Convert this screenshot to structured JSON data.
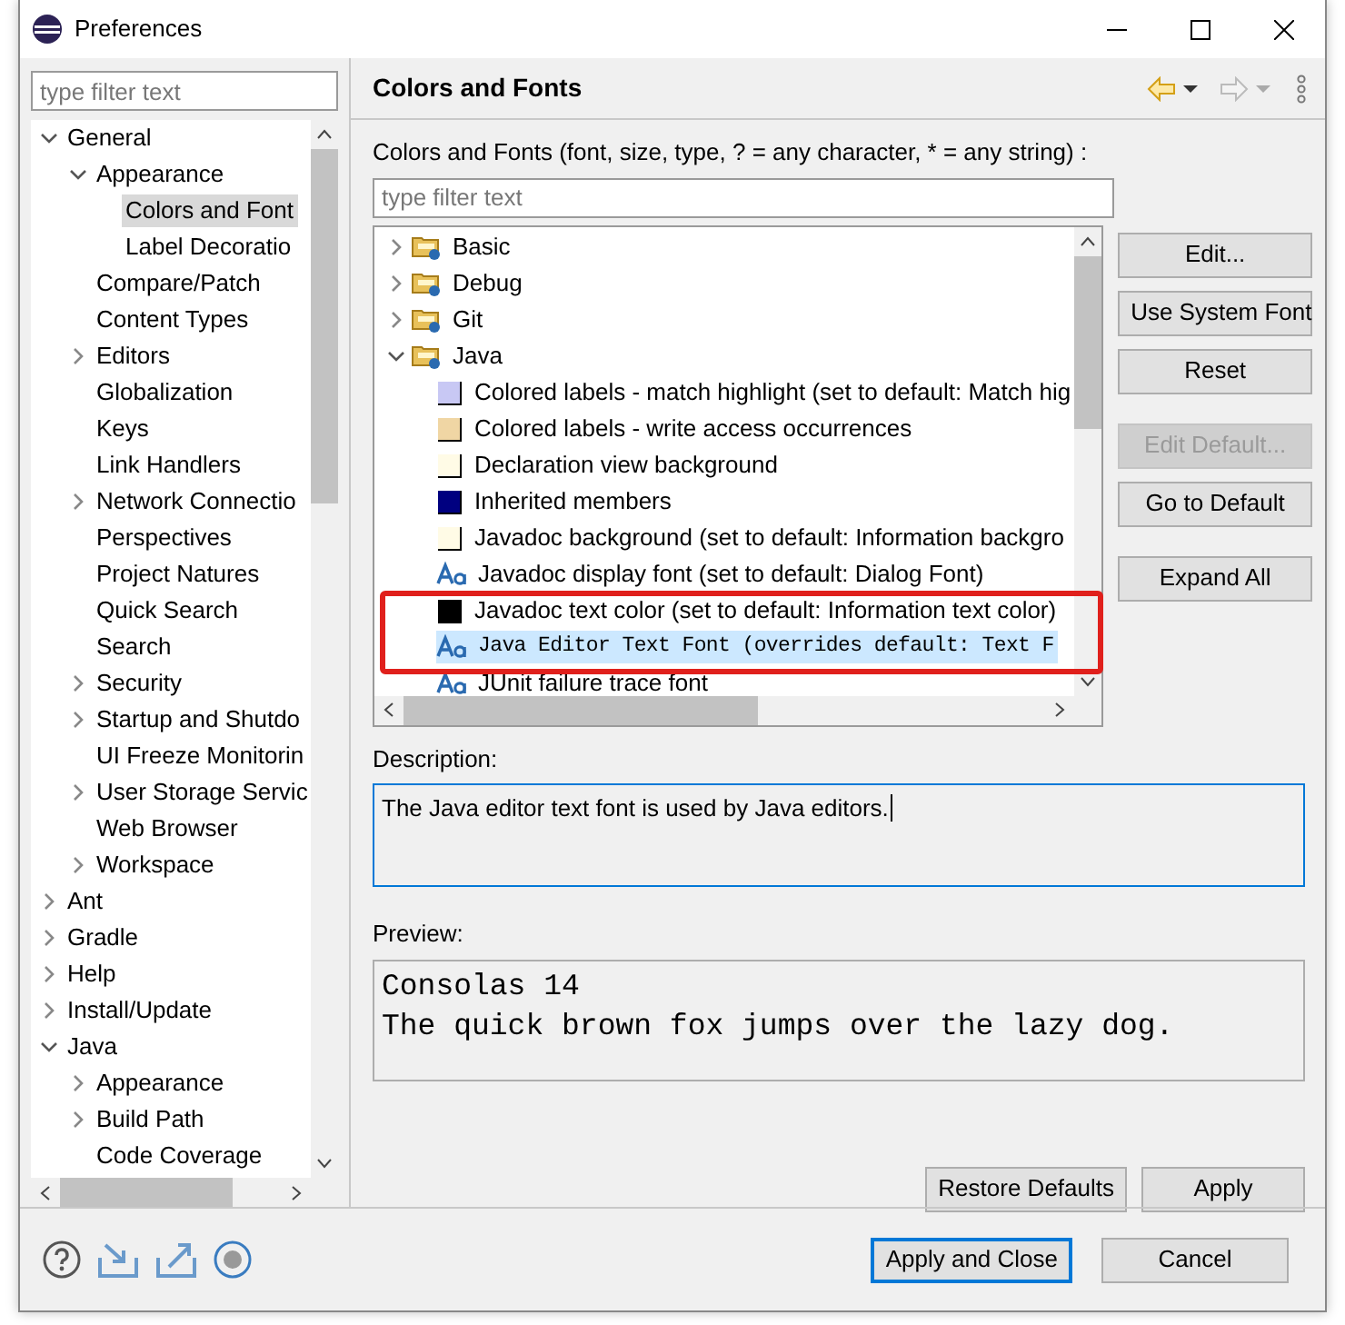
{
  "window": {
    "title": "Preferences"
  },
  "sidebar": {
    "filter": {
      "placeholder": "type filter text"
    },
    "items": [
      {
        "label": "General",
        "expanded": true,
        "selected": false,
        "children": [
          {
            "label": "Appearance",
            "expanded": true,
            "selected": false,
            "children": [
              {
                "label": "Colors and Font",
                "selected": true
              },
              {
                "label": "Label Decoratio",
                "selected": false
              }
            ]
          },
          {
            "label": "Compare/Patch",
            "selected": false
          },
          {
            "label": "Content Types",
            "selected": false
          },
          {
            "label": "Editors",
            "expanded": false,
            "selected": false
          },
          {
            "label": "Globalization",
            "selected": false
          },
          {
            "label": "Keys",
            "selected": false
          },
          {
            "label": "Link Handlers",
            "selected": false
          },
          {
            "label": "Network Connectio",
            "expanded": false,
            "selected": false
          },
          {
            "label": "Perspectives",
            "selected": false
          },
          {
            "label": "Project Natures",
            "selected": false
          },
          {
            "label": "Quick Search",
            "selected": false
          },
          {
            "label": "Search",
            "selected": false
          },
          {
            "label": "Security",
            "expanded": false,
            "selected": false
          },
          {
            "label": "Startup and Shutdo",
            "expanded": false,
            "selected": false
          },
          {
            "label": "UI Freeze Monitorin",
            "selected": false
          },
          {
            "label": "User Storage Servic",
            "expanded": false,
            "selected": false
          },
          {
            "label": "Web Browser",
            "selected": false
          },
          {
            "label": "Workspace",
            "expanded": false,
            "selected": false
          }
        ]
      },
      {
        "label": "Ant",
        "expanded": false,
        "selected": false
      },
      {
        "label": "Gradle",
        "expanded": false,
        "selected": false
      },
      {
        "label": "Help",
        "expanded": false,
        "selected": false
      },
      {
        "label": "Install/Update",
        "expanded": false,
        "selected": false
      },
      {
        "label": "Java",
        "expanded": true,
        "selected": false,
        "children": [
          {
            "label": "Appearance",
            "expanded": false,
            "selected": false
          },
          {
            "label": "Build Path",
            "expanded": false,
            "selected": false
          },
          {
            "label": "Code Coverage",
            "selected": false
          }
        ]
      }
    ]
  },
  "page": {
    "title": "Colors and Fonts",
    "nav": {
      "back_enabled": true,
      "forward_enabled": false
    },
    "filter_label": "Colors and Fonts (font, size, type, ? = any character, * = any string) :",
    "filter": {
      "placeholder": "type filter text"
    },
    "tree": [
      {
        "kind": "category",
        "label": "Basic",
        "expanded": false,
        "selected": false
      },
      {
        "kind": "category",
        "label": "Debug",
        "expanded": false,
        "selected": false
      },
      {
        "kind": "category",
        "label": "Git",
        "expanded": false,
        "selected": false
      },
      {
        "kind": "category",
        "label": "Java",
        "expanded": true,
        "selected": false,
        "children": [
          {
            "kind": "color",
            "label": "Colored labels - match highlight (set to default: Match hig",
            "color": "#c8c8f4",
            "selected": false
          },
          {
            "kind": "color",
            "label": "Colored labels - write access occurrences",
            "color": "#f0d6a4",
            "selected": false
          },
          {
            "kind": "color",
            "label": "Declaration view background",
            "color": "#fffbe6",
            "selected": false
          },
          {
            "kind": "color",
            "label": "Inherited members",
            "color": "#000080",
            "selected": false
          },
          {
            "kind": "color",
            "label": "Javadoc background (set to default: Information backgro",
            "color": "#fffbe6",
            "selected": false
          },
          {
            "kind": "font",
            "label": "Javadoc display font (set to default: Dialog Font)",
            "selected": false
          },
          {
            "kind": "color",
            "label": "Javadoc text color (set to default: Information text color)",
            "color": "#000000",
            "selected": false
          },
          {
            "kind": "font",
            "label": "Java Editor Text Font (overrides default: Text F",
            "monospace": true,
            "selected": true
          },
          {
            "kind": "font",
            "label": "JUnit failure trace font",
            "selected": false
          }
        ]
      }
    ],
    "side_buttons": [
      {
        "label": "Edit...",
        "disabled": false
      },
      {
        "label": "Use System Font",
        "disabled": false
      },
      {
        "label": "Reset",
        "disabled": false
      },
      {
        "label": "Edit Default...",
        "disabled": true
      },
      {
        "label": "Go to Default",
        "disabled": false
      },
      {
        "label": "Expand All",
        "disabled": false
      }
    ],
    "description_label": "Description:",
    "description": "The Java editor text font is used by Java editors.",
    "preview_label": "Preview:",
    "preview": [
      "Consolas 14",
      "The quick brown fox jumps over the lazy dog."
    ],
    "page_buttons": [
      {
        "label": "Restore Defaults"
      },
      {
        "label": "Apply"
      }
    ]
  },
  "dialog_buttons": [
    {
      "label": "Apply and Close",
      "default": true
    },
    {
      "label": "Cancel",
      "default": false
    }
  ]
}
